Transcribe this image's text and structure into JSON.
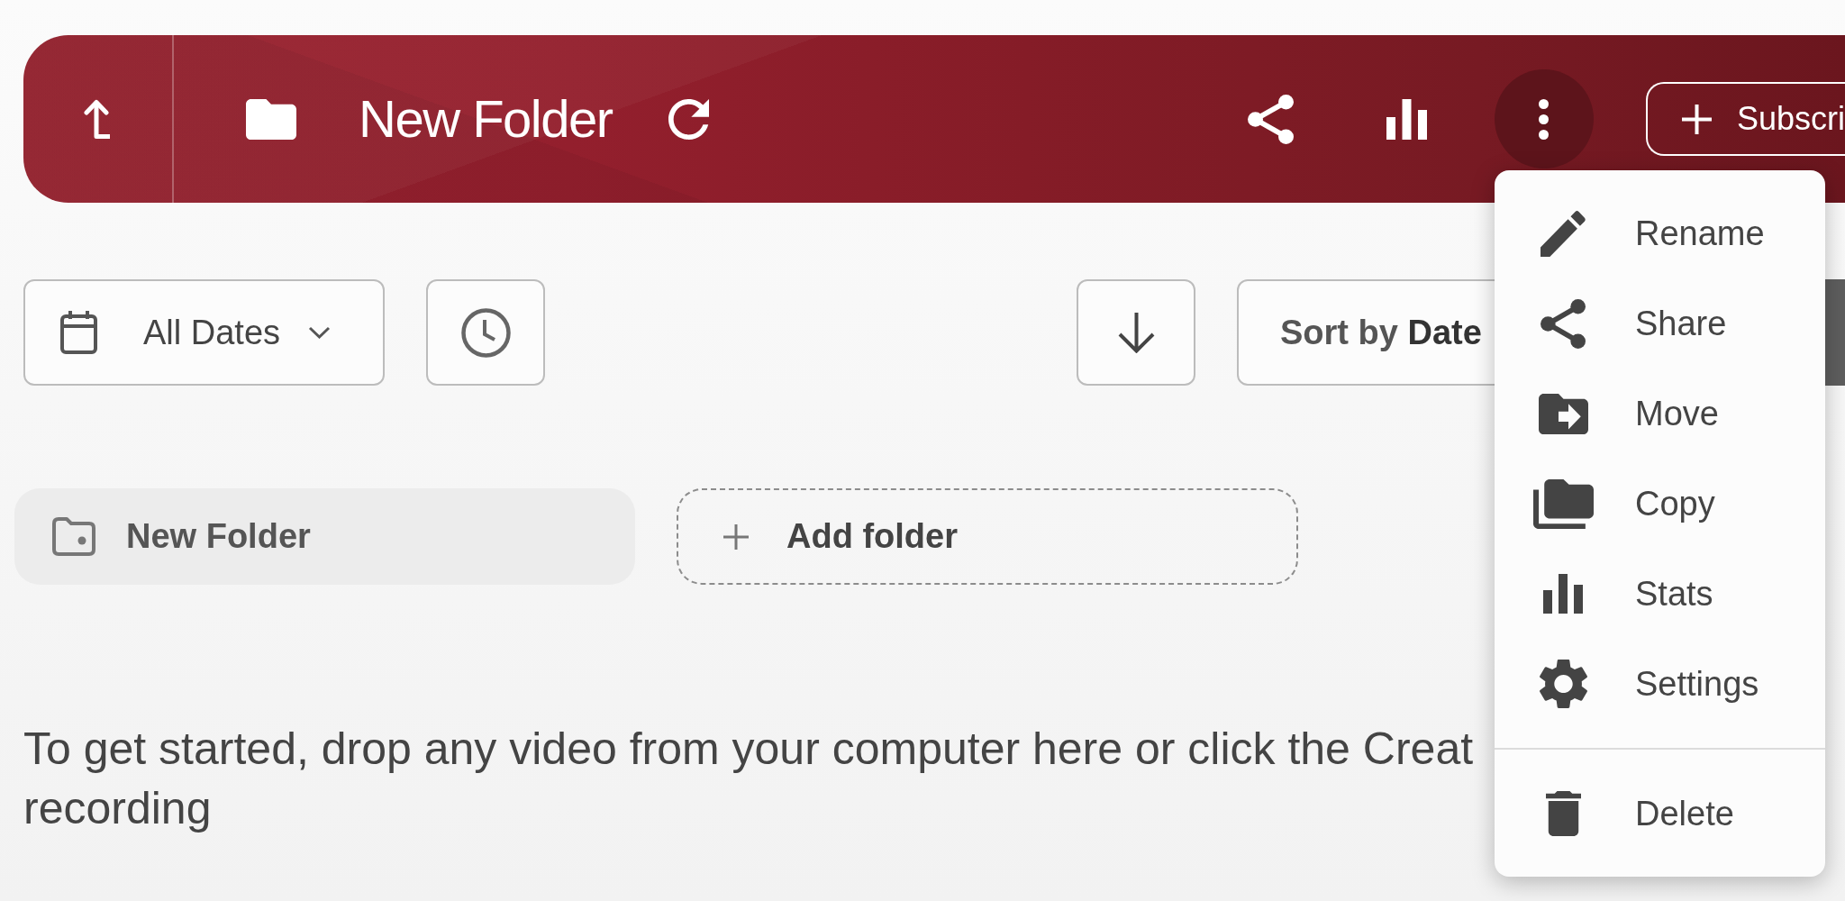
{
  "header": {
    "title": "New Folder",
    "more_button": {
      "expanded": true
    },
    "subscribe_button": {
      "label": "Subscri"
    }
  },
  "toolbar": {
    "date_filter": {
      "label": "All Dates"
    },
    "sort_button": {
      "label": "Sort by **Date**"
    }
  },
  "folders": [
    {
      "kind": "folder",
      "label": "New Folder"
    },
    {
      "kind": "add",
      "label": "Add folder"
    }
  ],
  "empty_message": {
    "first_line": "To get started, drop any video from your computer here or click the Creat",
    "second_line": "recording"
  },
  "menu": {
    "sections": [
      [
        {
          "label": "Rename"
        },
        {
          "label": "Share"
        },
        {
          "label": "Move"
        },
        {
          "label": "Copy"
        },
        {
          "label": "Stats"
        },
        {
          "label": "Settings"
        }
      ],
      [
        {
          "label": "Delete"
        }
      ]
    ]
  }
}
